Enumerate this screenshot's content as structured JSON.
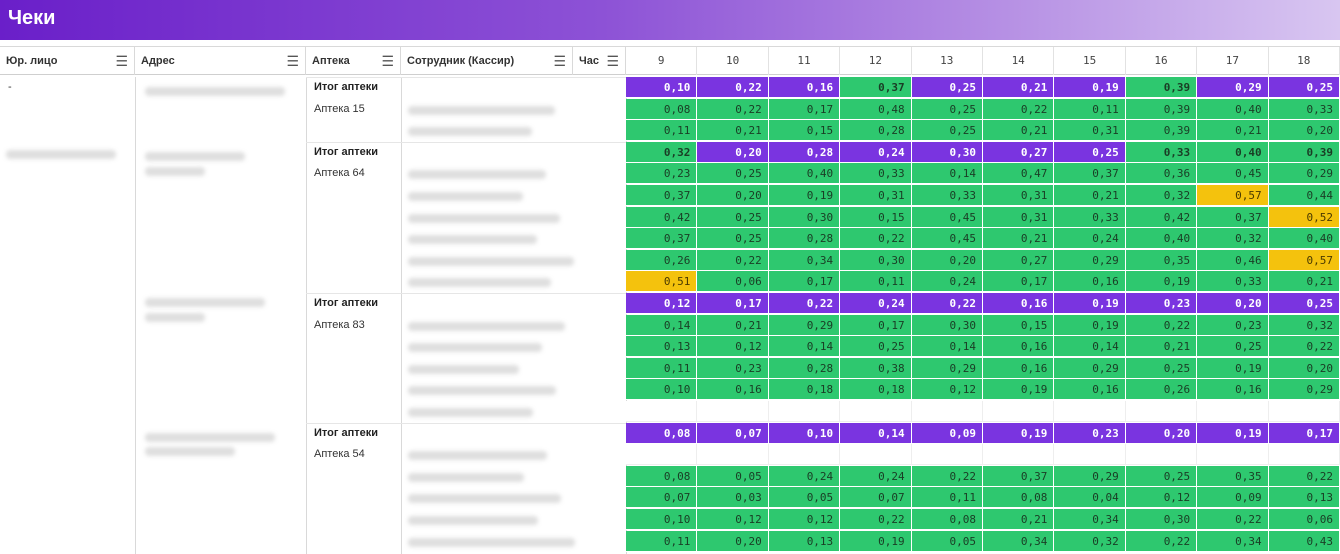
{
  "title": "Чеки",
  "columns": [
    "Юр. лицо",
    "Адрес",
    "Аптека",
    "Сотрудник (Кассир)",
    "Час"
  ],
  "hours": [
    "9",
    "10",
    "11",
    "12",
    "13",
    "14",
    "15",
    "16",
    "17",
    "18"
  ],
  "colors": {
    "green": "#2ec86f",
    "purple": "#7a34e0",
    "yellow": "#f4c20d"
  },
  "icons": {
    "menu": "hamburger-menu-icon"
  },
  "rows": [
    {
      "entity": "-",
      "pharmacy": "Итог аптеки",
      "total": true,
      "values": [
        "0,10",
        "0,22",
        "0,16",
        "0,37",
        "0,25",
        "0,21",
        "0,19",
        "0,39",
        "0,29",
        "0,25"
      ],
      "colors": [
        "p",
        "p",
        "p",
        "g",
        "p",
        "p",
        "p",
        "g",
        "p",
        "p"
      ]
    },
    {
      "pharmacy": "Аптека 15",
      "values": [
        "0,08",
        "0,22",
        "0,17",
        "0,48",
        "0,25",
        "0,22",
        "0,11",
        "0,39",
        "0,40",
        "0,33"
      ],
      "colors": "g"
    },
    {
      "values": [
        "0,11",
        "0,21",
        "0,15",
        "0,28",
        "0,25",
        "0,21",
        "0,31",
        "0,39",
        "0,21",
        "0,20"
      ],
      "colors": "g"
    },
    {
      "pharmacy": "Итог аптеки",
      "total": true,
      "values": [
        "0,32",
        "0,20",
        "0,28",
        "0,24",
        "0,30",
        "0,27",
        "0,25",
        "0,33",
        "0,40",
        "0,39"
      ],
      "colors": [
        "g",
        "p",
        "p",
        "p",
        "p",
        "p",
        "p",
        "g",
        "g",
        "g"
      ]
    },
    {
      "pharmacy": "Аптека 64",
      "values": [
        "0,23",
        "0,25",
        "0,40",
        "0,33",
        "0,14",
        "0,47",
        "0,37",
        "0,36",
        "0,45",
        "0,29"
      ],
      "colors": "g"
    },
    {
      "values": [
        "0,37",
        "0,20",
        "0,19",
        "0,31",
        "0,33",
        "0,31",
        "0,21",
        "0,32",
        "0,57",
        "0,44"
      ],
      "colors": [
        "g",
        "g",
        "g",
        "g",
        "g",
        "g",
        "g",
        "g",
        "y",
        "g"
      ]
    },
    {
      "values": [
        "0,42",
        "0,25",
        "0,30",
        "0,15",
        "0,45",
        "0,31",
        "0,33",
        "0,42",
        "0,37",
        "0,52"
      ],
      "colors": [
        "g",
        "g",
        "g",
        "g",
        "g",
        "g",
        "g",
        "g",
        "g",
        "y"
      ]
    },
    {
      "values": [
        "0,37",
        "0,25",
        "0,28",
        "0,22",
        "0,45",
        "0,21",
        "0,24",
        "0,40",
        "0,32",
        "0,40"
      ],
      "colors": "g"
    },
    {
      "values": [
        "0,26",
        "0,22",
        "0,34",
        "0,30",
        "0,20",
        "0,27",
        "0,29",
        "0,35",
        "0,46",
        "0,57"
      ],
      "colors": [
        "g",
        "g",
        "g",
        "g",
        "g",
        "g",
        "g",
        "g",
        "g",
        "y"
      ]
    },
    {
      "values": [
        "0,51",
        "0,06",
        "0,17",
        "0,11",
        "0,24",
        "0,17",
        "0,16",
        "0,19",
        "0,33",
        "0,21"
      ],
      "colors": [
        "y",
        "g",
        "g",
        "g",
        "g",
        "g",
        "g",
        "g",
        "g",
        "g"
      ]
    },
    {
      "pharmacy": "Итог аптеки",
      "total": true,
      "values": [
        "0,12",
        "0,17",
        "0,22",
        "0,24",
        "0,22",
        "0,16",
        "0,19",
        "0,23",
        "0,20",
        "0,25"
      ],
      "colors": "p"
    },
    {
      "pharmacy": "Аптека 83",
      "values": [
        "0,14",
        "0,21",
        "0,29",
        "0,17",
        "0,30",
        "0,15",
        "0,19",
        "0,22",
        "0,23",
        "0,32"
      ],
      "colors": "g"
    },
    {
      "values": [
        "0,13",
        "0,12",
        "0,14",
        "0,25",
        "0,14",
        "0,16",
        "0,14",
        "0,21",
        "0,25",
        "0,22"
      ],
      "colors": "g"
    },
    {
      "values": [
        "0,11",
        "0,23",
        "0,28",
        "0,38",
        "0,29",
        "0,16",
        "0,29",
        "0,25",
        "0,19",
        "0,20"
      ],
      "colors": "g"
    },
    {
      "values": [
        "0,10",
        "0,16",
        "0,18",
        "0,18",
        "0,12",
        "0,19",
        "0,16",
        "0,26",
        "0,16",
        "0,29"
      ],
      "colors": "g"
    },
    {
      "values": [
        "",
        "",
        "",
        "",
        "",
        "",
        "",
        "",
        "",
        ""
      ],
      "colors": "e"
    },
    {
      "pharmacy": "Итог аптеки",
      "total": true,
      "values": [
        "0,08",
        "0,07",
        "0,10",
        "0,14",
        "0,09",
        "0,19",
        "0,23",
        "0,20",
        "0,19",
        "0,17"
      ],
      "colors": "p"
    },
    {
      "pharmacy": "Аптека 54",
      "values": [
        "",
        "",
        "",
        "",
        "",
        "",
        "",
        "",
        "",
        ""
      ],
      "colors": "e"
    },
    {
      "values": [
        "0,08",
        "0,05",
        "0,24",
        "0,24",
        "0,22",
        "0,37",
        "0,29",
        "0,25",
        "0,35",
        "0,22"
      ],
      "colors": "g"
    },
    {
      "values": [
        "0,07",
        "0,03",
        "0,05",
        "0,07",
        "0,11",
        "0,08",
        "0,04",
        "0,12",
        "0,09",
        "0,13"
      ],
      "colors": "g"
    },
    {
      "values": [
        "0,10",
        "0,12",
        "0,12",
        "0,22",
        "0,08",
        "0,21",
        "0,34",
        "0,30",
        "0,22",
        "0,06"
      ],
      "colors": "g"
    },
    {
      "values": [
        "0,11",
        "0,20",
        "0,13",
        "0,19",
        "0,05",
        "0,34",
        "0,32",
        "0,22",
        "0,34",
        "0,43"
      ],
      "colors": "g"
    }
  ]
}
